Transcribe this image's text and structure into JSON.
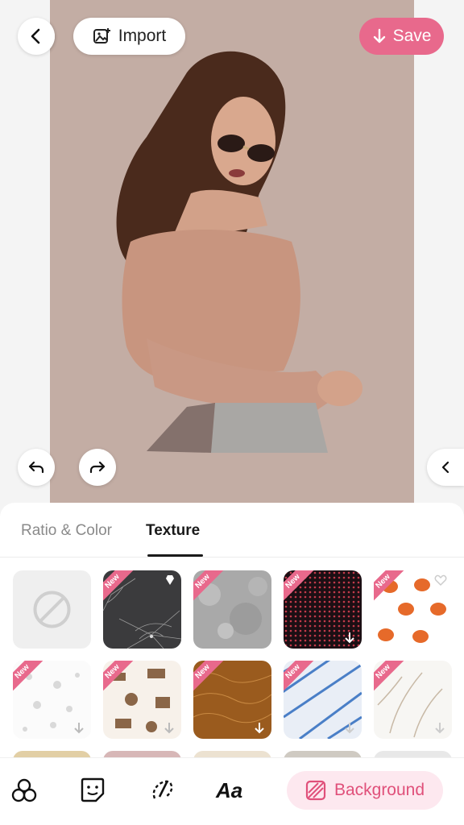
{
  "header": {
    "import_label": "Import",
    "save_label": "Save",
    "back_icon": "chevron-left-icon",
    "import_icon": "image-plus-icon",
    "save_icon": "arrow-down-icon"
  },
  "canvas": {
    "background_color": "#c3ada4",
    "undo_icon": "undo-icon",
    "redo_icon": "redo-icon",
    "expand_icon": "chevron-left-icon"
  },
  "panel": {
    "tabs": [
      {
        "label": "Ratio & Color",
        "active": false
      },
      {
        "label": "Texture",
        "active": true
      }
    ],
    "new_badge": "New",
    "textures": [
      {
        "name": "none",
        "new": false
      },
      {
        "name": "spider-web",
        "new": true,
        "premium": true
      },
      {
        "name": "grey-grunge",
        "new": true
      },
      {
        "name": "dark-dots",
        "new": true,
        "download": true
      },
      {
        "name": "pumpkins",
        "new": true,
        "favorite": true
      },
      {
        "name": "halloween-white",
        "new": true,
        "download": true
      },
      {
        "name": "toile-brown",
        "new": true,
        "download": true
      },
      {
        "name": "leather",
        "new": true,
        "download": true
      },
      {
        "name": "denim",
        "new": true,
        "download": true
      },
      {
        "name": "wheat",
        "new": true,
        "download": true
      }
    ]
  },
  "toolbar": {
    "tools": [
      "layers-icon",
      "sticker-icon",
      "brush-icon",
      "text-icon"
    ],
    "text_tool_label": "Aa",
    "background_label": "Background",
    "accent_color": "#e8698c"
  }
}
